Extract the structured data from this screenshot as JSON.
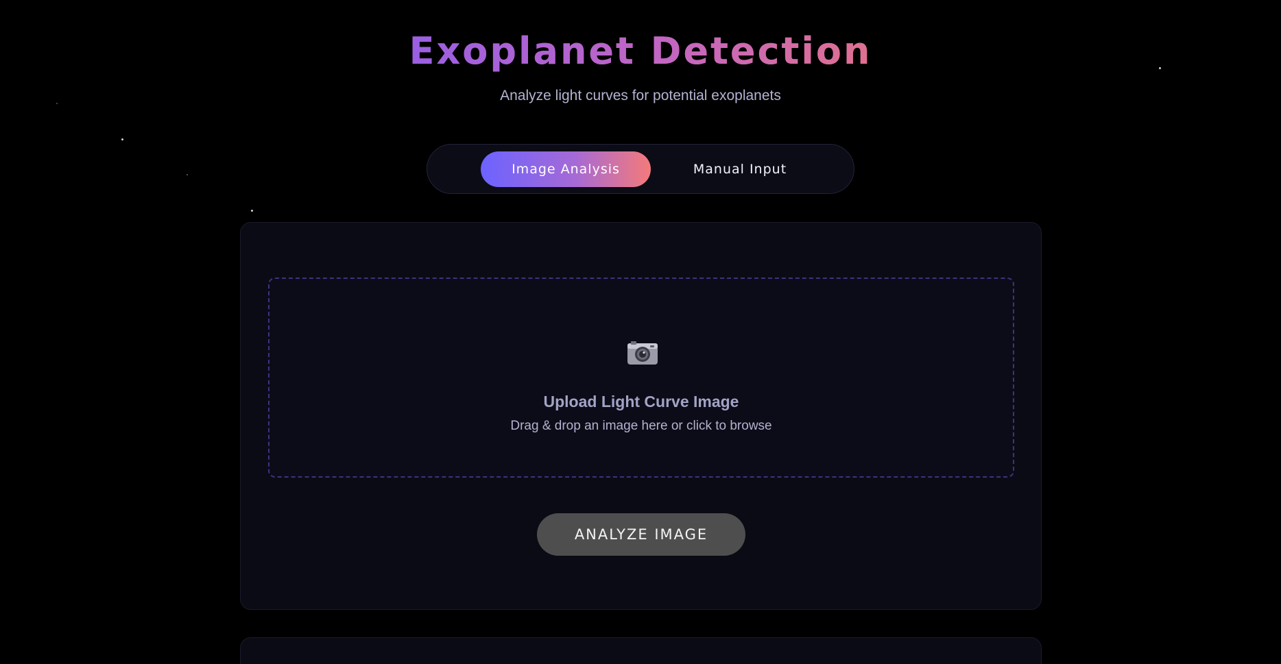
{
  "header": {
    "title": "Exoplanet Detection",
    "subtitle": "Analyze light curves for potential exoplanets"
  },
  "tabs": [
    {
      "label": "Image Analysis",
      "active": true
    },
    {
      "label": "Manual Input",
      "active": false
    }
  ],
  "upload": {
    "icon": "camera-icon",
    "title": "Upload Light Curve Image",
    "hint": "Drag & drop an image here or click to browse"
  },
  "actions": {
    "analyze_label": "ANALYZE IMAGE"
  },
  "colors": {
    "background": "#000000",
    "panel": "#0b0b15",
    "title_gradient_start": "#9a5fe2",
    "title_gradient_end": "#e07090",
    "tab_gradient_start": "#6c63ff",
    "tab_gradient_end": "#f47a7a",
    "dropzone_border": "#3c3380",
    "button_disabled": "#4e4e4e"
  }
}
